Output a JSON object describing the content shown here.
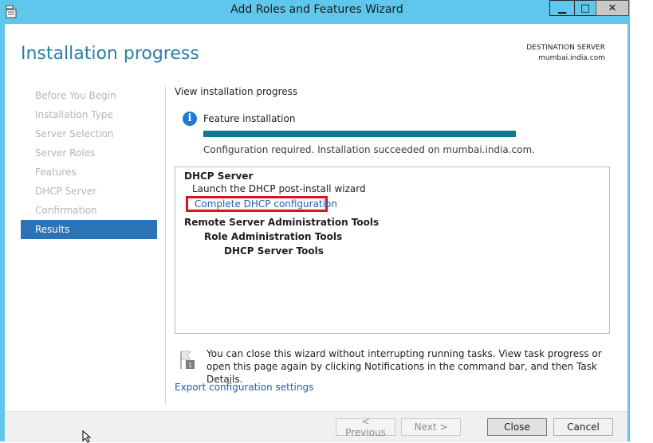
{
  "window": {
    "title": "Add Roles and Features Wizard",
    "controls": {
      "minimize": "▁",
      "maximize": "□",
      "close": "✕"
    }
  },
  "header": {
    "page_title": "Installation progress",
    "destination_label": "DESTINATION SERVER",
    "destination_server": "mumbai.india.com"
  },
  "nav": {
    "items": [
      {
        "label": "Before You Begin",
        "state": "disabled"
      },
      {
        "label": "Installation Type",
        "state": "disabled"
      },
      {
        "label": "Server Selection",
        "state": "disabled"
      },
      {
        "label": "Server Roles",
        "state": "disabled"
      },
      {
        "label": "Features",
        "state": "disabled"
      },
      {
        "label": "DHCP Server",
        "state": "disabled"
      },
      {
        "label": "Confirmation",
        "state": "disabled"
      },
      {
        "label": "Results",
        "state": "active"
      }
    ]
  },
  "content": {
    "subheading": "View installation progress",
    "feature_label": "Feature installation",
    "progress_percent": 100,
    "status_text": "Configuration required. Installation succeeded on mumbai.india.com.",
    "results": {
      "dhcp_header": "DHCP Server",
      "post_install": "Launch the DHCP post-install wizard",
      "complete_link": "Complete DHCP configuration",
      "rsat": "Remote Server Administration Tools",
      "role_admin": "Role Administration Tools",
      "dhcp_tools": "DHCP Server Tools"
    },
    "notification": "You can close this wizard without interrupting running tasks. View task progress or open this page again by clicking Notifications in the command bar, and then Task Details.",
    "export_link": "Export configuration settings"
  },
  "buttons": {
    "previous": "< Previous",
    "next": "Next >",
    "close": "Close",
    "cancel": "Cancel"
  },
  "colors": {
    "titlebar": "#5fc6ec",
    "accent": "#2a7fa6",
    "nav_active": "#2b73b7",
    "progress": "#0e7a8c",
    "highlight": "#e0111d",
    "link": "#1e5fb3"
  }
}
